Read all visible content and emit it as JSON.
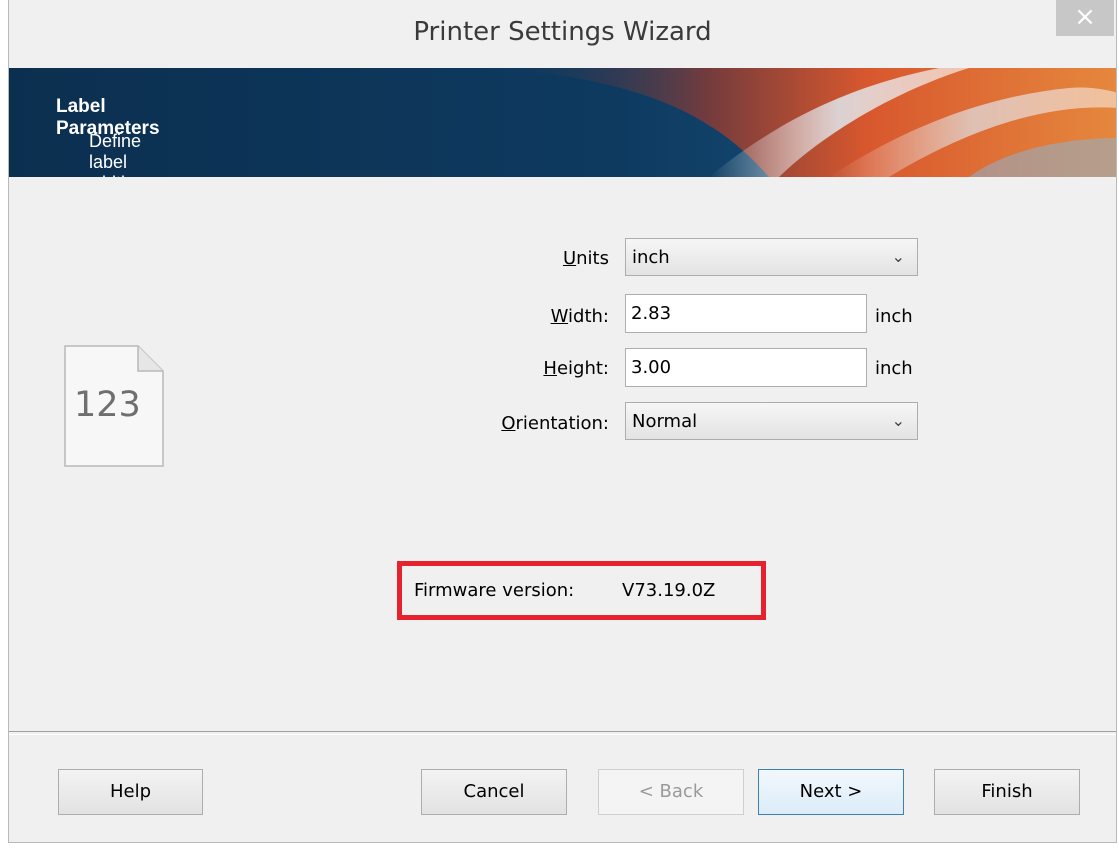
{
  "window": {
    "title": "Printer Settings Wizard",
    "close_glyph": "×"
  },
  "banner": {
    "title": "Label Parameters",
    "subtitle": "Define label width, label height and orientation."
  },
  "form": {
    "units": {
      "label_prefix": "",
      "label_accel": "U",
      "label_rest": "nits",
      "value": "inch"
    },
    "width": {
      "label_accel": "W",
      "label_rest": "idth:",
      "value": "2.83",
      "unit": "inch"
    },
    "height": {
      "label_accel": "H",
      "label_rest": "eight:",
      "value": "3.00",
      "unit": "inch"
    },
    "orientation": {
      "label_accel": "O",
      "label_rest": "rientation:",
      "value": "Normal"
    }
  },
  "icon": {
    "name": "label-document-icon",
    "text": "123"
  },
  "firmware": {
    "label": "Firmware version:",
    "value": "V73.19.0Z",
    "highlight_color": "#e5222e"
  },
  "buttons": {
    "help": "Help",
    "cancel": "Cancel",
    "back": "< Back",
    "next": "Next >",
    "finish": "Finish"
  },
  "colors": {
    "banner_bg": "#0b3253",
    "accent_orange": "#e2582a"
  }
}
